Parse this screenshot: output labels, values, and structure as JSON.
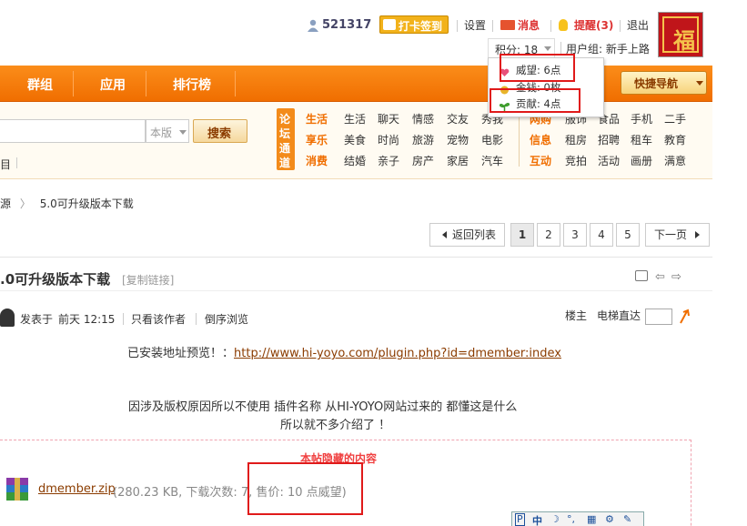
{
  "header": {
    "uid": "521317",
    "checkin_label": "打卡签到",
    "settings": "设置",
    "sep": "|",
    "messages": "消息",
    "remind": "提醒(3)",
    "logout": "退出",
    "points": "积分: 18",
    "user_group": "用户组: 新手上路",
    "avatar_glyph": "福"
  },
  "points_popup": {
    "items": [
      {
        "label": "威望: 6点",
        "icon": "heart-icon",
        "color": "#e8517a"
      },
      {
        "label": "金钱: 0枚",
        "icon": "coin-icon",
        "color": "#e8b42a"
      },
      {
        "label": "贡献: 4点",
        "icon": "sprout-icon",
        "color": "#3a9a2a"
      }
    ]
  },
  "nav": {
    "items": [
      "群组",
      "应用",
      "排行榜"
    ],
    "quick_nav": "快捷导航"
  },
  "search": {
    "scope": "本版",
    "button": "搜索",
    "sub_label": "目"
  },
  "forum_dir": [
    "论",
    "坛",
    "通",
    "道"
  ],
  "categories": {
    "col1": {
      "labels": [
        "生活",
        "享乐",
        "消费"
      ],
      "items": [
        [
          "生活",
          "聊天",
          "情感",
          "交友",
          "秀我"
        ],
        [
          "美食",
          "时尚",
          "旅游",
          "宠物",
          "电影"
        ],
        [
          "结婚",
          "亲子",
          "房产",
          "家居",
          "汽车"
        ]
      ]
    },
    "col2": {
      "labels": [
        "网购",
        "信息",
        "互动"
      ],
      "items": [
        [
          "服饰",
          "食品",
          "手机",
          "二手"
        ],
        [
          "租房",
          "招聘",
          "租车",
          "教育"
        ],
        [
          "竞拍",
          "活动",
          "画册",
          "满意"
        ]
      ]
    }
  },
  "breadcrumb": {
    "prefix": "源",
    "arrow": "〉",
    "current": "5.0可升级版本下载"
  },
  "pagination": {
    "back": "返回列表",
    "pages": [
      "1",
      "2",
      "3",
      "4",
      "5"
    ],
    "active": "1",
    "next": "下一页"
  },
  "post": {
    "title": ".0可升级版本下载",
    "copy_link": "[复制链接]",
    "meta": {
      "posted": "发表于",
      "time": "前天 12:15",
      "only_author": "只看该作者",
      "reverse": "倒序浏览",
      "floor": "楼主",
      "jump": "电梯直达"
    },
    "install_prefix": "已安装地址预览！：",
    "install_url": "http://www.hi-yoyo.com/plugin.php?id=dmember:index",
    "body_line1": "因涉及版权原因所以不使用  插件名称  从HI-YOYO网站过来的  都懂这是什么",
    "body_line2": "所以就不多介绍了  ！",
    "hidden_title": "本帖隐藏的内容",
    "attachment": {
      "name": "dmember.zip",
      "meta": "(280.23 KB, 下载次数: 7, 售价: 10 点威望)"
    }
  },
  "ime": {
    "items": [
      "P",
      "中",
      "☽",
      "°,",
      "▦",
      "⚙",
      "✎"
    ]
  },
  "colors": {
    "nav_orange": "#f06e00",
    "highlight_red": "#e01a1a",
    "link_brown": "#8b3c00"
  }
}
